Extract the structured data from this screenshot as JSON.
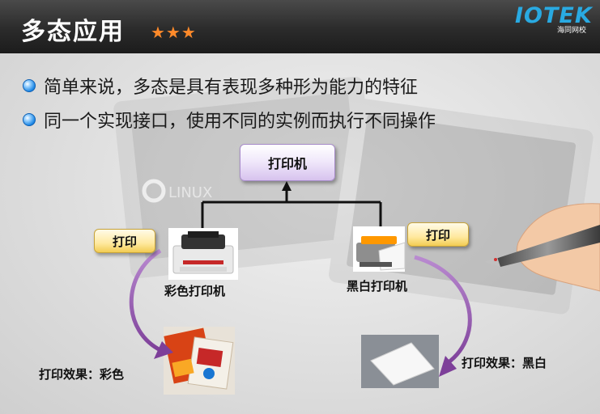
{
  "header": {
    "title": "多态应用",
    "stars": "★★★",
    "logo_text": "IOTEK",
    "logo_sub": "海同网校"
  },
  "bullets": [
    "简单来说，多态是具有表现多种形为能力的特征",
    "同一个实现接口，使用不同的实例而执行不同操作"
  ],
  "background": {
    "watermark_text": "LINUX"
  },
  "diagram": {
    "parent": "打印机",
    "left": {
      "method": "打印",
      "name": "彩色打印机",
      "result": "打印效果：彩色"
    },
    "right": {
      "method": "打印",
      "name": "黑白打印机",
      "result": "打印效果：黑白"
    }
  },
  "colors": {
    "header_bg": "#2b2b2b",
    "bullet_blue": "#1e88e5",
    "stars": "#ff8a2a",
    "logo": "#29aae2",
    "arrow_purple": "#8a4fa8"
  }
}
